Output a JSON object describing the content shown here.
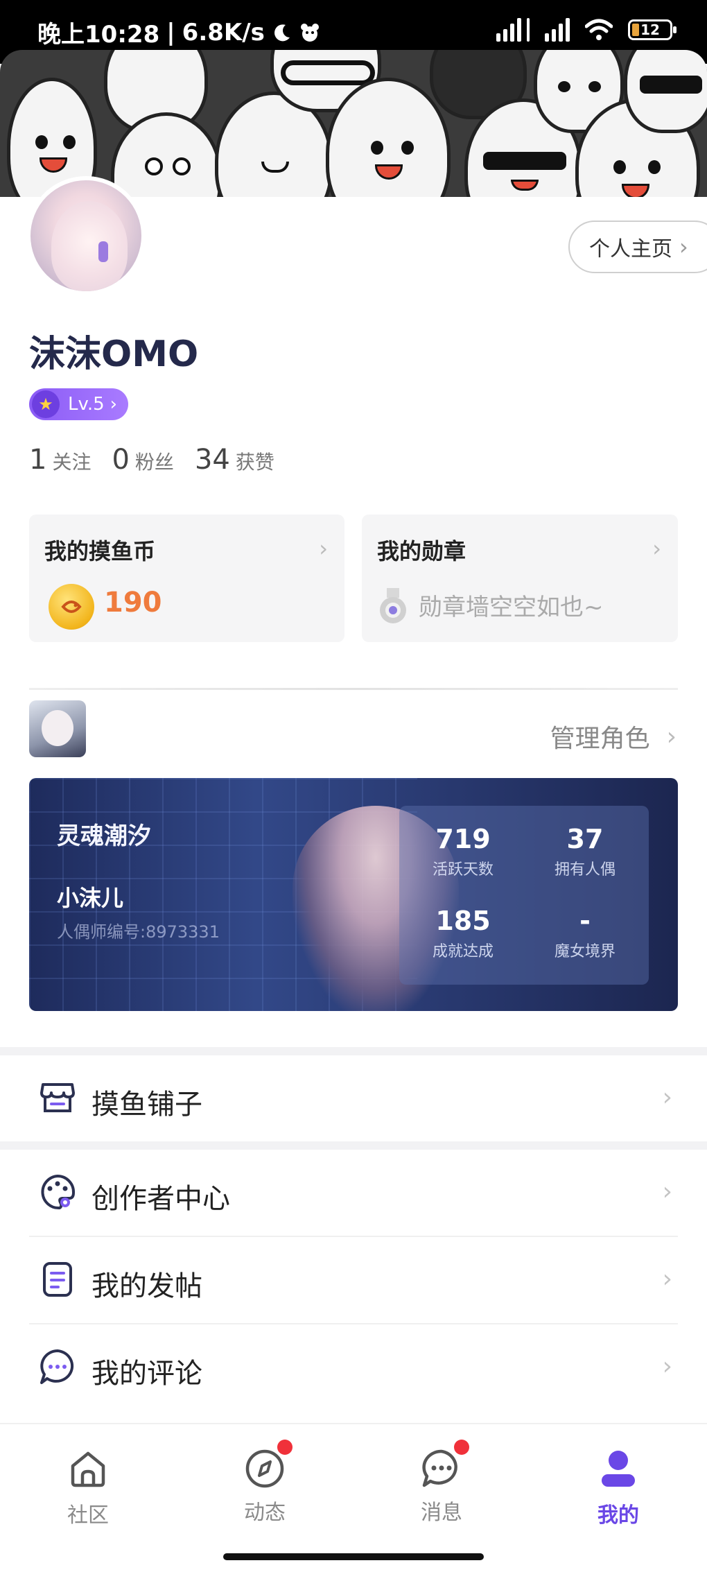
{
  "status_bar": {
    "time": "晚上10:28",
    "speed": "6.8K/s",
    "battery": "12"
  },
  "profile": {
    "nickname": "沫沫OMO",
    "level": "Lv.5",
    "homepage_label": "个人主页",
    "stats": [
      {
        "value": "1",
        "label": "关注"
      },
      {
        "value": "0",
        "label": "粉丝"
      },
      {
        "value": "34",
        "label": "获赞"
      }
    ]
  },
  "cards": {
    "coins": {
      "title": "我的摸鱼币",
      "value": "190"
    },
    "medals": {
      "title": "我的勋章",
      "empty_text": "勋章墙空空如也~"
    }
  },
  "role": {
    "manage_label": "管理角色",
    "name": "灵魂潮汐",
    "nick": "小沫儿",
    "id_text": "人偶师编号:8973331",
    "stats": [
      {
        "value": "719",
        "label": "活跃天数"
      },
      {
        "value": "37",
        "label": "拥有人偶"
      },
      {
        "value": "185",
        "label": "成就达成"
      },
      {
        "value": "-",
        "label": "魔女境界"
      }
    ]
  },
  "menu": {
    "shop": "摸鱼铺子",
    "creator": "创作者中心",
    "posts": "我的发帖",
    "comments": "我的评论"
  },
  "tabs": [
    {
      "label": "社区",
      "icon": "home-icon"
    },
    {
      "label": "动态",
      "icon": "compass-icon"
    },
    {
      "label": "消息",
      "icon": "chat-icon"
    },
    {
      "label": "我的",
      "icon": "person-icon"
    }
  ],
  "colors": {
    "accent": "#6a47e6",
    "coin": "#ef7b3d",
    "badge": "#f0313a"
  }
}
